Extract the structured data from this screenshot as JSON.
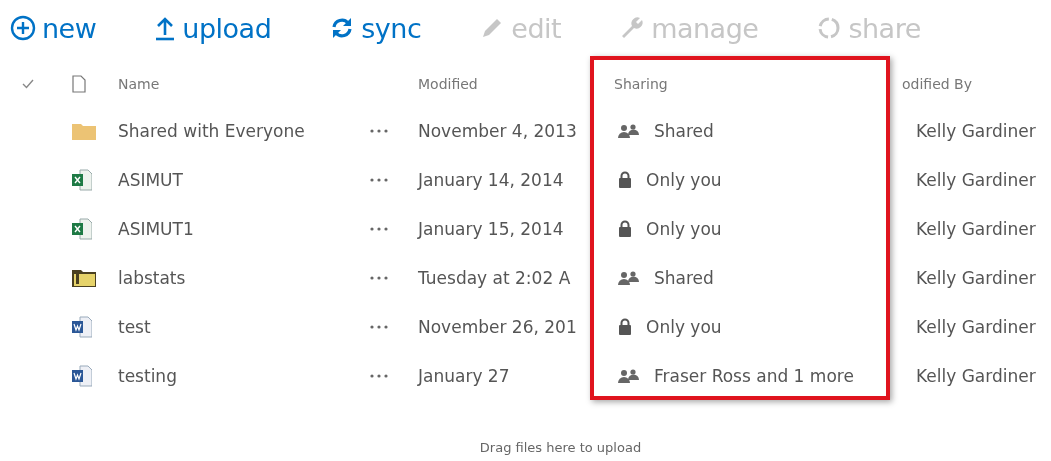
{
  "toolbar": [
    {
      "label": "new",
      "kind": "new",
      "disabled": false
    },
    {
      "label": "upload",
      "kind": "upload",
      "disabled": false
    },
    {
      "label": "sync",
      "kind": "sync",
      "disabled": false
    },
    {
      "label": "edit",
      "kind": "edit",
      "disabled": true
    },
    {
      "label": "manage",
      "kind": "manage",
      "disabled": true
    },
    {
      "label": "share",
      "kind": "share",
      "disabled": true
    }
  ],
  "table": {
    "columns": [
      "Name",
      "Modified",
      "Sharing",
      "odified By"
    ],
    "rows": [
      {
        "name": "Shared with Everyone",
        "kind": "folder",
        "modified": "November 4, 2013",
        "sharing": {
          "label": "Shared",
          "kind": "shared"
        },
        "modified_by": "Kelly Gardiner"
      },
      {
        "name": "ASIMUT",
        "kind": "excel",
        "modified": "January 14, 2014",
        "sharing": {
          "label": "Only you",
          "kind": "private"
        },
        "modified_by": "Kelly Gardiner"
      },
      {
        "name": "ASIMUT1",
        "kind": "excel",
        "modified": "January 15, 2014",
        "sharing": {
          "label": "Only you",
          "kind": "private"
        },
        "modified_by": "Kelly Gardiner"
      },
      {
        "name": "labstats",
        "kind": "shared-folder",
        "modified": "Tuesday at 2:02 A",
        "sharing": {
          "label": "Shared",
          "kind": "shared"
        },
        "modified_by": "Kelly Gardiner"
      },
      {
        "name": "test",
        "kind": "word",
        "modified": "November 26, 201",
        "sharing": {
          "label": "Only you",
          "kind": "private"
        },
        "modified_by": "Kelly Gardiner"
      },
      {
        "name": "testing",
        "kind": "word",
        "modified": "January 27",
        "sharing": {
          "label": "Fraser Ross and 1 more",
          "kind": "shared"
        },
        "modified_by": "Kelly Gardiner"
      }
    ]
  },
  "drop_hint": "Drag files here to upload"
}
